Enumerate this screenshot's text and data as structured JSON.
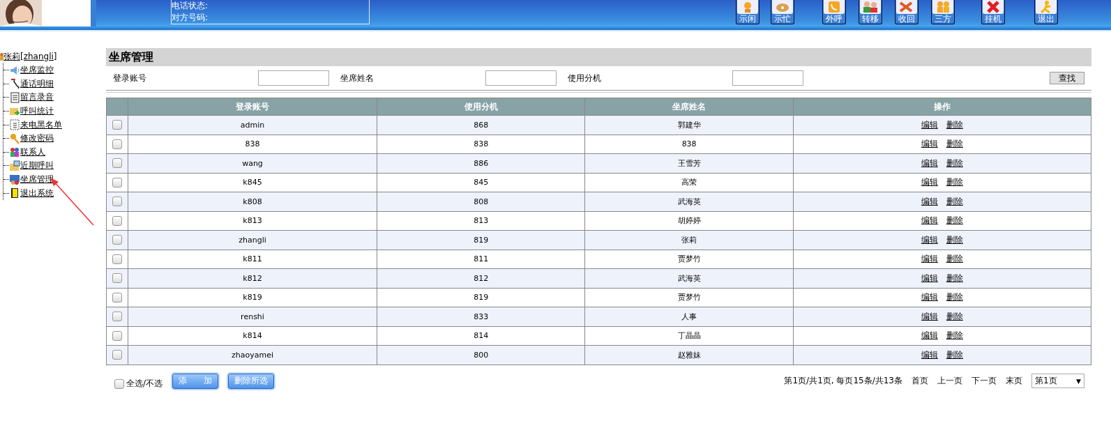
{
  "header": {
    "picture": {
      "kind": "picture"
    },
    "status_lines": [
      "电话状态:",
      "对方号码:"
    ],
    "toolbar": [
      {
        "label": "示闲"
      },
      {
        "label": "示忙"
      },
      {
        "label": "外呼"
      },
      {
        "label": "转移"
      },
      {
        "label": "收回"
      },
      {
        "label": "三方"
      },
      {
        "label": "挂机"
      },
      {
        "label": "退出"
      }
    ]
  },
  "sidebar": {
    "root": {
      "label": "张莉[zhangli]",
      "children": [
        {
          "label": "坐席监控"
        },
        {
          "label": "通话明细"
        },
        {
          "label": "留言录音"
        },
        {
          "label": "呼叫统计"
        },
        {
          "label": "来电黑名单"
        },
        {
          "label": "修改密码"
        },
        {
          "label": "联系人"
        },
        {
          "label": "近期呼叫"
        },
        {
          "label": "坐席管理"
        },
        {
          "label": "退出系统"
        }
      ]
    }
  },
  "page_title": "坐席管理",
  "search": {
    "fields": [
      {
        "label": "登录账号"
      },
      {
        "label": "坐席姓名"
      },
      {
        "label": "使用分机"
      }
    ],
    "button": "查找"
  },
  "table": {
    "columns": [
      "登录账号",
      "使用分机",
      "坐席姓名",
      "操作"
    ],
    "rows": [
      {
        "checked": false,
        "account": "admin",
        "extension": "868",
        "name": "郭建华",
        "actions": [
          "编辑",
          "删除"
        ]
      },
      {
        "checked": false,
        "account": "838",
        "extension": "838",
        "name": "838",
        "actions": [
          "编辑",
          "删除"
        ]
      },
      {
        "checked": false,
        "account": "wang",
        "extension": "886",
        "name": "王雪芳",
        "actions": [
          "编辑",
          "删除"
        ]
      },
      {
        "checked": false,
        "account": "k845",
        "extension": "845",
        "name": "高荣",
        "actions": [
          "编辑",
          "删除"
        ]
      },
      {
        "checked": false,
        "account": "k808",
        "extension": "808",
        "name": "武海英",
        "actions": [
          "编辑",
          "删除"
        ]
      },
      {
        "checked": false,
        "account": "k813",
        "extension": "813",
        "name": "胡婷婷",
        "actions": [
          "编辑",
          "删除"
        ]
      },
      {
        "checked": false,
        "account": "zhangli",
        "extension": "819",
        "name": "张莉",
        "actions": [
          "编辑",
          "删除"
        ]
      },
      {
        "checked": false,
        "account": "k811",
        "extension": "811",
        "name": "贾梦竹",
        "actions": [
          "编辑",
          "删除"
        ]
      },
      {
        "checked": false,
        "account": "k812",
        "extension": "812",
        "name": "武海英",
        "actions": [
          "编辑",
          "删除"
        ]
      },
      {
        "checked": false,
        "account": "k819",
        "extension": "819",
        "name": "贾梦竹",
        "actions": [
          "编辑",
          "删除"
        ]
      },
      {
        "checked": false,
        "account": "renshi",
        "extension": "833",
        "name": "人事",
        "actions": [
          "编辑",
          "删除"
        ]
      },
      {
        "checked": false,
        "account": "k814",
        "extension": "814",
        "name": "丁晶晶",
        "actions": [
          "编辑",
          "删除"
        ]
      },
      {
        "checked": false,
        "account": "zhaoyamei",
        "extension": "800",
        "name": "赵雅妹",
        "actions": [
          "编辑",
          "删除"
        ]
      }
    ]
  },
  "footer": {
    "select_all": {
      "label": "全选/不选",
      "checked": false
    },
    "buttons": [
      "添　　加",
      "删除所选"
    ],
    "pager": {
      "summary": "第1页/共1页, 每页15条/共13条",
      "links": [
        "首页",
        "上一页",
        "下一页",
        "末页"
      ],
      "page_select": {
        "value": "第1页",
        "arrow": "▼"
      }
    }
  }
}
